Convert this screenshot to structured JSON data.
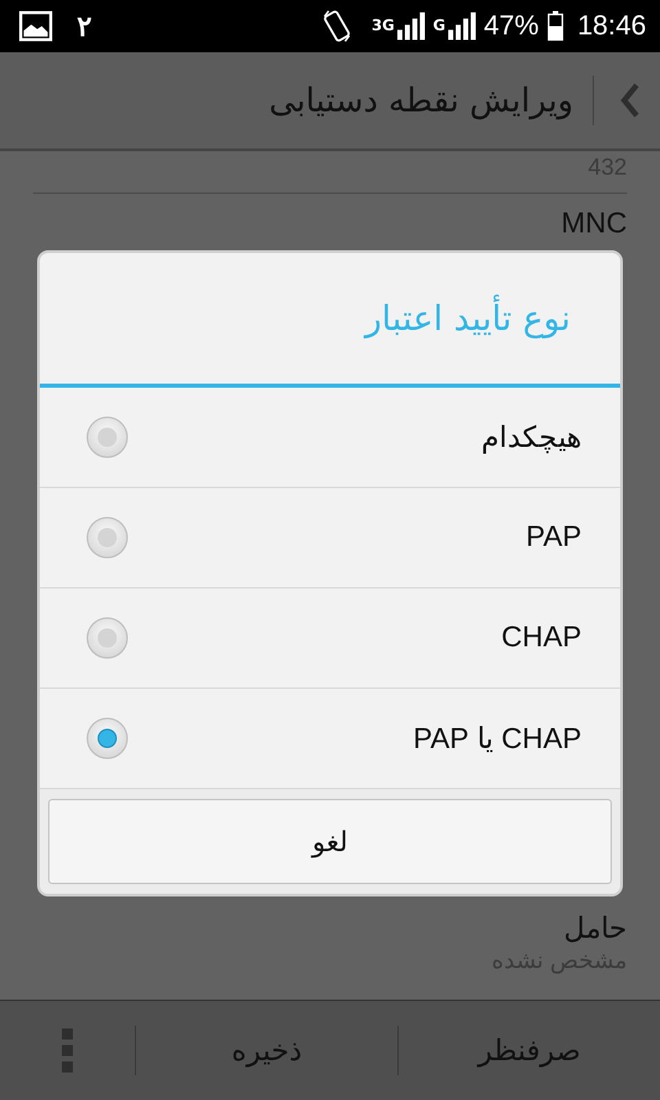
{
  "status_bar": {
    "notification_count": "٢",
    "network_1": "3G",
    "network_2": "G",
    "battery": "47%",
    "time": "18:46"
  },
  "app_bar": {
    "title": "ویرایش نقطه دستیابی"
  },
  "fields": [
    {
      "value": "432"
    },
    {
      "label": "MNC"
    },
    {
      "label": "حامل",
      "value": "مشخص نشده"
    }
  ],
  "dialog": {
    "title": "نوع تأیید اعتبار",
    "options": [
      {
        "label": "هیچکدام",
        "selected": false
      },
      {
        "label": "PAP",
        "selected": false
      },
      {
        "label": "CHAP",
        "selected": false
      },
      {
        "label": "CHAP یا PAP",
        "selected": true
      }
    ],
    "cancel": "لغو"
  },
  "bottom_bar": {
    "actions": [
      "صرفنظر",
      "ذخیره"
    ]
  }
}
